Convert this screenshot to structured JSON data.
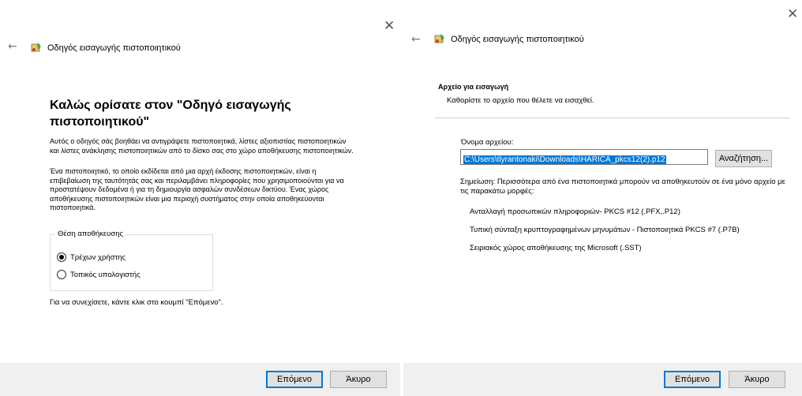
{
  "left_dialog": {
    "title": "Οδηγός εισαγωγής πιστοποιητικού",
    "heading": "Καλώς ορίσατε στον \"Οδηγό εισαγωγής πιστοποιητικού\"",
    "paragraph1": "Αυτός ο οδηγός σάς βοηθάει να αντιγράψετε πιστοποιητικά, λίστες αξιοπιστίας πιστοποιητικών και λίστες ανάκλησης πιστοποιητικών από το δίσκο σας στο χώρο αποθήκευσης πιστοποιητικών.",
    "paragraph2": "Ένα πιστοποιητικό, το οποίο εκδίδεται από μια αρχή έκδοσης πιστοποιητικών, είναι η επιβεβαίωση της ταυτότητάς σας και περιλαμβάνει πληροφορίες που χρησιμοποιούνται για να προστατέψουν δεδομένα ή για τη δημιουργία ασφαλών συνδέσεων δικτύου. Ένας χώρος αποθήκευσης πιστοποιητικών είναι μια περιοχή συστήματος στην οποία αποθηκεύονται πιστοποιητικά.",
    "store_group": {
      "legend": "Θέση αποθήκευσης",
      "options": [
        {
          "label": "Τρέχων χρήστης",
          "selected": true
        },
        {
          "label": "Τοπικός υπολογιστής",
          "selected": false
        }
      ]
    },
    "continue_text": "Για να συνεχίσετε, κάντε κλικ στο κουμπί \"Επόμενο\".",
    "next_label": "Επόμενο",
    "cancel_label": "Άκυρο"
  },
  "right_dialog": {
    "title": "Οδηγός εισαγωγής πιστοποιητικού",
    "section_title": "Αρχείο για εισαγωγή",
    "section_desc": "Καθορίστε το αρχείο που θέλετε να εισαχθεί.",
    "file_label": "Όνομα αρχείου:",
    "file_value": "C:\\Users\\tlyrantonaki\\Downloads\\HARICA_pkcs12(2).p12",
    "browse_label": "Αναζήτηση...",
    "note": "Σημείωση: Περισσότερα από ένα πιστοποιητικά μπορούν να αποθηκευτούν σε ένα μόνο αρχείο με τις παρακάτω μορφές:",
    "formats": [
      "Ανταλλαγή προσωπικών πληροφοριών- PKCS #12 (.PFX,.P12)",
      "Τυπική σύνταξη κρυπτογραφημένων μηνυμάτων - Πιστοποιητικά PKCS #7 (.P7B)",
      "Σειριακός χώρος αποθήκευσης της Microsoft (.SST)"
    ],
    "next_label": "Επόμενο",
    "cancel_label": "Άκυρο"
  },
  "icons": {
    "close": "close-icon",
    "back": "back-arrow-icon",
    "wizard": "certificate-wizard-icon"
  }
}
